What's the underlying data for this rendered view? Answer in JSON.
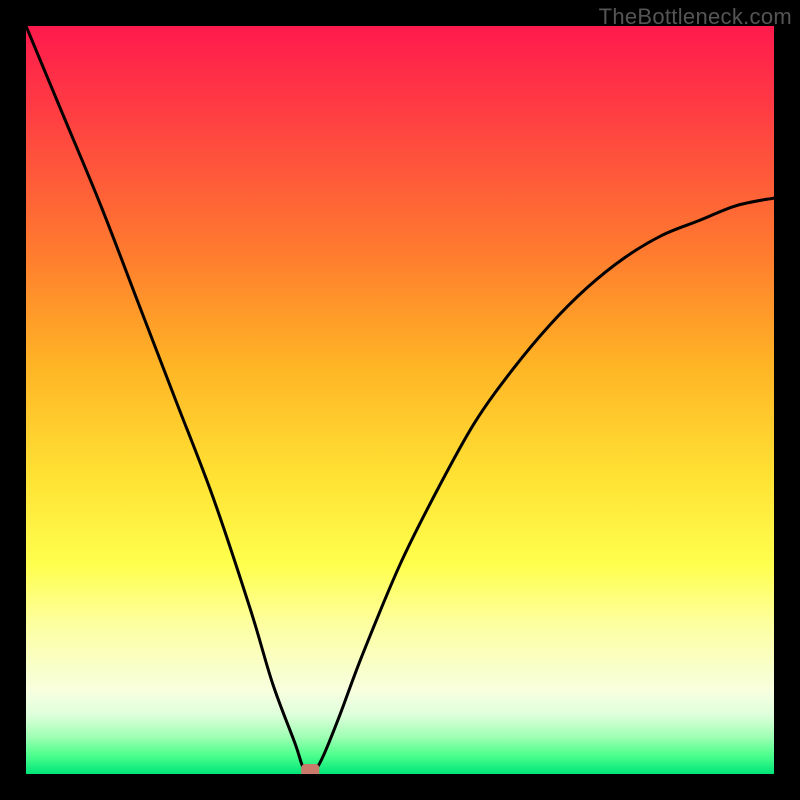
{
  "watermark": "TheBottleneck.com",
  "chart_data": {
    "type": "line",
    "title": "",
    "xlabel": "",
    "ylabel": "",
    "xlim": [
      0,
      100
    ],
    "ylim": [
      0,
      100
    ],
    "background_gradient": {
      "orientation": "vertical",
      "stops": [
        {
          "pos": 0,
          "color": "#ff1a4d",
          "meaning": "high-bottleneck"
        },
        {
          "pos": 50,
          "color": "#ffd633",
          "meaning": "moderate"
        },
        {
          "pos": 100,
          "color": "#00e57a",
          "meaning": "no-bottleneck"
        }
      ]
    },
    "series": [
      {
        "name": "bottleneck-curve",
        "color": "#000000",
        "x": [
          0,
          5,
          10,
          15,
          20,
          25,
          30,
          33,
          36,
          37,
          38,
          39,
          40,
          42,
          45,
          50,
          55,
          60,
          65,
          70,
          75,
          80,
          85,
          90,
          95,
          100
        ],
        "y": [
          100,
          88,
          76,
          63,
          50,
          37,
          22,
          12,
          4,
          1,
          0,
          1,
          3,
          8,
          16,
          28,
          38,
          47,
          54,
          60,
          65,
          69,
          72,
          74,
          76,
          77
        ]
      }
    ],
    "marker": {
      "x": 38,
      "y": 0,
      "color": "#c97a6a",
      "shape": "rounded-rect"
    }
  }
}
